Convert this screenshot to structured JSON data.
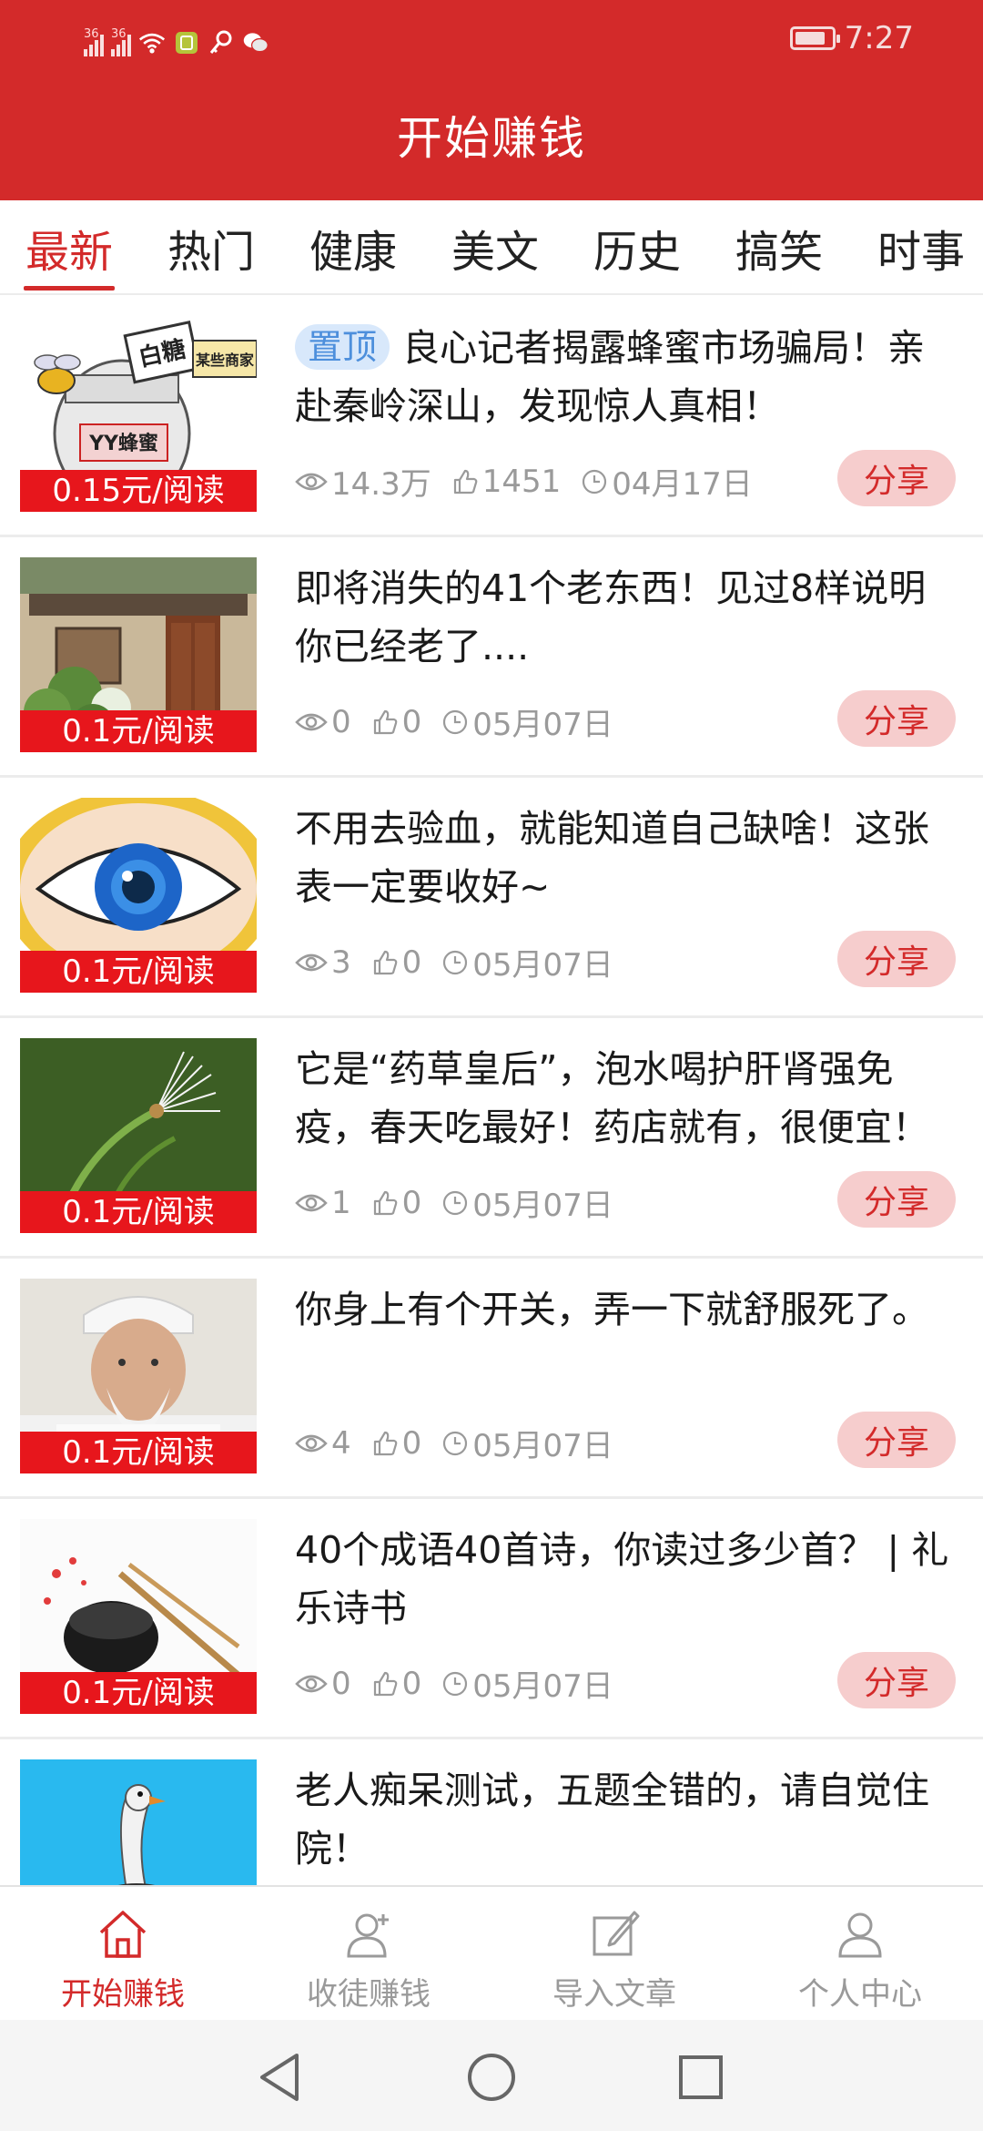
{
  "status_bar": {
    "signal1_label": "36",
    "signal2_label": "36",
    "time": "7:27"
  },
  "header": {
    "title": "开始赚钱"
  },
  "tabs": [
    {
      "label": "最新",
      "active": true
    },
    {
      "label": "热门",
      "active": false
    },
    {
      "label": "健康",
      "active": false
    },
    {
      "label": "美文",
      "active": false
    },
    {
      "label": "历史",
      "active": false
    },
    {
      "label": "搞笑",
      "active": false
    },
    {
      "label": "时事",
      "active": false
    }
  ],
  "articles": [
    {
      "pin": "置顶",
      "title": "良心记者揭露蜂蜜市场骗局！亲赴秦岭深山，发现惊人真相！",
      "price": "0.15元/阅读",
      "views": "14.3万",
      "likes": "1451",
      "date": "04月17日",
      "share": "分享",
      "thumb": "honey-jar",
      "thumb_text": [
        "白糖",
        "某些商家",
        "YY蜂蜜"
      ]
    },
    {
      "pin": "",
      "title": "即将消失的41个老东西！见过8样说明你已经老了....",
      "price": "0.1元/阅读",
      "views": "0",
      "likes": "0",
      "date": "05月07日",
      "share": "分享",
      "thumb": "old-house"
    },
    {
      "pin": "",
      "title": "不用去验血，就能知道自己缺啥！这张表一定要收好~",
      "price": "0.1元/阅读",
      "views": "3",
      "likes": "0",
      "date": "05月07日",
      "share": "分享",
      "thumb": "eye"
    },
    {
      "pin": "",
      "title": "它是“药草皇后”，泡水喝护肝肾强免疫，春天吃最好！药店就有，很便宜！",
      "price": "0.1元/阅读",
      "views": "1",
      "likes": "0",
      "date": "05月07日",
      "share": "分享",
      "thumb": "dandelion"
    },
    {
      "pin": "",
      "title": "你身上有个开关，弄一下就舒服死了。",
      "price": "0.1元/阅读",
      "views": "4",
      "likes": "0",
      "date": "05月07日",
      "share": "分享",
      "thumb": "old-man"
    },
    {
      "pin": "",
      "title": "40个成语40首诗，你读过多少首？ | 礼乐诗书",
      "price": "0.1元/阅读",
      "views": "0",
      "likes": "0",
      "date": "05月07日",
      "share": "分享",
      "thumb": "ink-brush"
    },
    {
      "pin": "",
      "title": "老人痴呆测试，五题全错的，请自觉住院！",
      "price": "",
      "views": "",
      "likes": "",
      "date": "",
      "share": "",
      "thumb": "ostrich"
    }
  ],
  "bottom_nav": [
    {
      "label": "开始赚钱",
      "icon": "home-icon",
      "active": true
    },
    {
      "label": "收徒赚钱",
      "icon": "add-user-icon",
      "active": false
    },
    {
      "label": "导入文章",
      "icon": "edit-icon",
      "active": false
    },
    {
      "label": "个人中心",
      "icon": "user-icon",
      "active": false
    }
  ],
  "colors": {
    "brand_red": "#d32a2a",
    "price_red": "#e7161c",
    "share_bg": "#f6cdcd",
    "pin_bg": "#d8e8fb",
    "pin_text": "#4d8fdc",
    "meta_gray": "#9a9a9a"
  }
}
